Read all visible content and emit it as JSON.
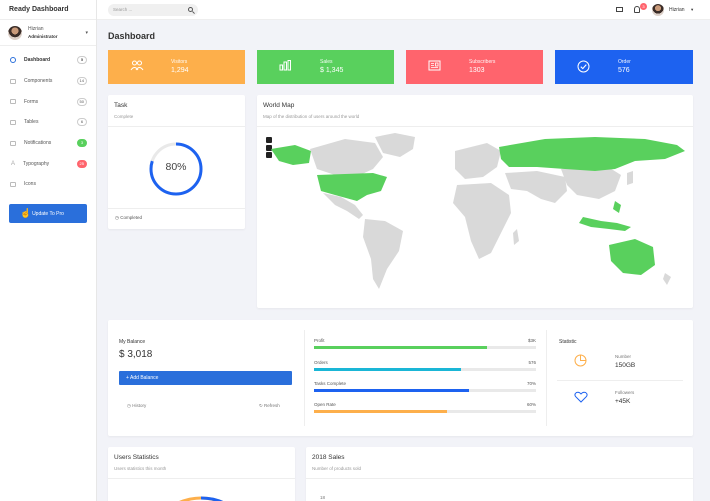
{
  "app": {
    "brand": "Ready Dashboard"
  },
  "user": {
    "name": "Hizrian",
    "role": "Administrator"
  },
  "sidebar": {
    "items": [
      {
        "label": "Dashboard",
        "badge": "5",
        "badge_style": "outline",
        "active": true,
        "icon": "dashboard-icon"
      },
      {
        "label": "Components",
        "badge": "14",
        "badge_style": "outline",
        "icon": "components-icon"
      },
      {
        "label": "Forms",
        "badge": "50",
        "badge_style": "outline",
        "icon": "forms-icon"
      },
      {
        "label": "Tables",
        "badge": "6",
        "badge_style": "outline",
        "icon": "tables-icon"
      },
      {
        "label": "Notifications",
        "badge": "3",
        "badge_style": "green",
        "icon": "notifications-icon"
      },
      {
        "label": "Typography",
        "badge": "25",
        "badge_style": "red",
        "icon": "typography-icon"
      },
      {
        "label": "Icons",
        "badge": "",
        "icon": "icons-icon"
      }
    ],
    "pro_button": "Update To Pro"
  },
  "topbar": {
    "search_placeholder": "Search ...",
    "notification_count": "3",
    "user_name": "Hizrian",
    "caret": "▾"
  },
  "page": {
    "title": "Dashboard"
  },
  "stats": [
    {
      "label": "Visitors",
      "value": "1,294",
      "color": "#fdaf4b",
      "icon": "users-icon"
    },
    {
      "label": "Sales",
      "value": "$ 1,345",
      "color": "#59d05d",
      "icon": "bar-chart-icon"
    },
    {
      "label": "Subscribers",
      "value": "1303",
      "color": "#ff646d",
      "icon": "newspaper-icon"
    },
    {
      "label": "Order",
      "value": "576",
      "color": "#1d62f0",
      "icon": "check-circle-icon"
    }
  ],
  "task": {
    "title": "Task",
    "subtitle": "Complete",
    "percent_text": "80%",
    "percent": 80,
    "footer": "Completed"
  },
  "world_map": {
    "title": "World Map",
    "subtitle": "Map of the distribution of users around the world",
    "highlight_color": "#59d05d",
    "zoom_in": "+",
    "zoom_out": "−"
  },
  "balance": {
    "label": "My Balance",
    "value": "$ 3,018",
    "add_button": "+ Add Balance",
    "history": "History",
    "refresh": "Refresh"
  },
  "progress": [
    {
      "label": "Profit",
      "value_text": "$3K",
      "fraction": 0.78,
      "color": "#59d05d"
    },
    {
      "label": "Orders",
      "value_text": "576",
      "fraction": 0.66,
      "color": "#1ab6d6"
    },
    {
      "label": "Tasks Complete",
      "value_text": "70%",
      "fraction": 0.7,
      "color": "#1d62f0"
    },
    {
      "label": "Open Rate",
      "value_text": "60%",
      "fraction": 0.6,
      "color": "#fdaf4b"
    }
  ],
  "statistic": {
    "title": "Statistic",
    "items": [
      {
        "label": "Number",
        "value": "150GB",
        "icon": "pie-chart-icon",
        "color": "#fdaf4b"
      },
      {
        "label": "Followers",
        "value": "+45K",
        "icon": "heart-icon",
        "color": "#1d62f0"
      }
    ]
  },
  "users_statistics": {
    "title": "Users Statistics",
    "subtitle": "Users statistics this month"
  },
  "sales_2018": {
    "title": "2018 Sales",
    "subtitle": "Number of products sold",
    "first_tick": "18"
  }
}
